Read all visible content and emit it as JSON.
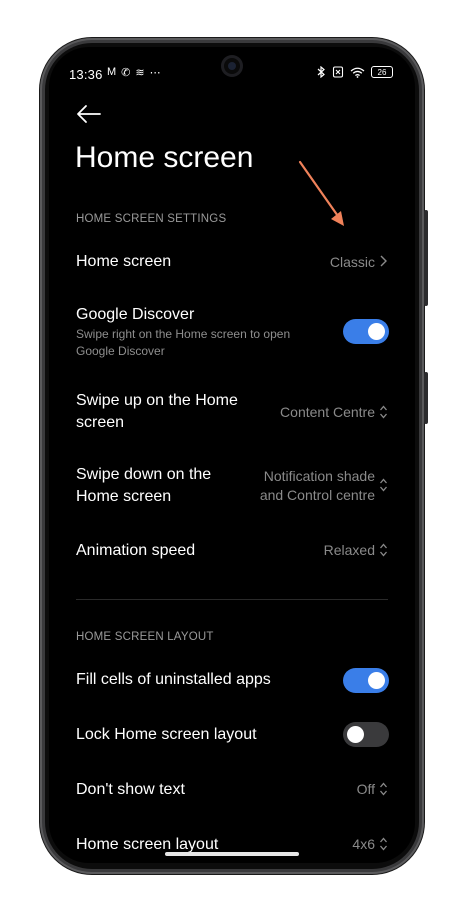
{
  "status": {
    "time": "13:36",
    "notif_icons": [
      "M",
      "✆",
      "≋",
      "⋯"
    ],
    "battery": "26"
  },
  "page": {
    "title": "Home screen"
  },
  "sections": {
    "settings_label": "HOME SCREEN SETTINGS",
    "layout_label": "HOME SCREEN LAYOUT"
  },
  "rows": {
    "home_screen": {
      "label": "Home screen",
      "value": "Classic"
    },
    "google_discover": {
      "label": "Google Discover",
      "sub_line1": "Swipe right on the Home screen to open",
      "sub_line2": "Google Discover",
      "enabled": true
    },
    "swipe_up": {
      "label_line1": "Swipe up on the Home",
      "label_line2": "screen",
      "value": "Content Centre"
    },
    "swipe_down": {
      "label_line1": "Swipe down on the",
      "label_line2": "Home screen",
      "value_line1": "Notification shade",
      "value_line2": "and Control centre"
    },
    "animation_speed": {
      "label": "Animation speed",
      "value": "Relaxed"
    },
    "fill_cells": {
      "label": "Fill cells of uninstalled apps",
      "enabled": true
    },
    "lock_layout": {
      "label": "Lock Home screen layout",
      "enabled": false
    },
    "dont_show_text": {
      "label": "Don't show text",
      "value": "Off"
    },
    "home_layout": {
      "label": "Home screen layout",
      "value": "4x6"
    }
  },
  "colors": {
    "toggle_on": "#3a7ee8",
    "toggle_off": "#3a3a3c",
    "annotation_arrow": "#f0825a"
  }
}
